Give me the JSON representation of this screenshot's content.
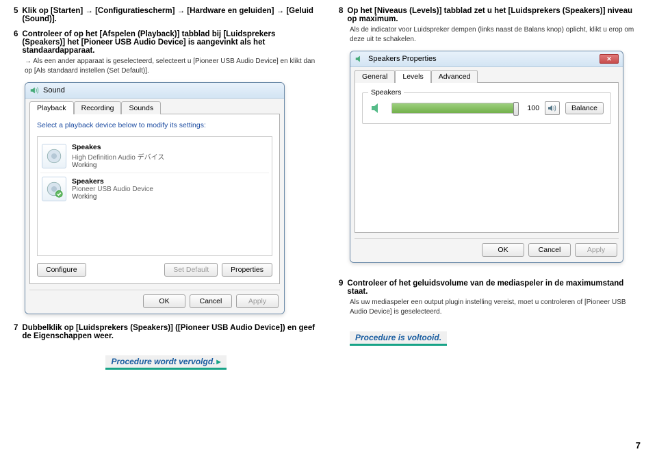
{
  "left": {
    "step5": {
      "num": "5",
      "text": "Klik op [Starten] → [Configuratiescherm] → [Hardware en geluiden] → [Geluid (Sound)]."
    },
    "step6": {
      "num": "6",
      "text": "Controleer of op het [Afspelen (Playback)] tabblad bij [Luidsprekers (Speakers)] het [Pioneer USB Audio Device] is aangevinkt als het standaardapparaat.",
      "note": "→ Als een ander apparaat is geselecteerd, selecteert u [Pioneer USB Audio Device] en klikt dan op [Als standaard instellen (Set Default)]."
    },
    "sound": {
      "title": "Sound",
      "tabs": {
        "playback": "Playback",
        "recording": "Recording",
        "sounds": "Sounds"
      },
      "prompt": "Select a playback device below to modify its settings:",
      "dev1": {
        "name": "Speakes",
        "sub": "High Definition Audio デバイス",
        "stat": "Working"
      },
      "dev2": {
        "name": "Speakers",
        "sub": "Pioneer USB Audio Device",
        "stat": "Working"
      },
      "buttons": {
        "configure": "Configure",
        "setdefault": "Set Default",
        "properties": "Properties",
        "ok": "OK",
        "cancel": "Cancel",
        "apply": "Apply"
      }
    },
    "step7": {
      "num": "7",
      "text": "Dubbelklik op [Luidsprekers (Speakers)] ([Pioneer USB Audio Device]) en geef de Eigenschappen weer."
    },
    "callout": "Procedure wordt vervolgd."
  },
  "right": {
    "step8": {
      "num": "8",
      "text": "Op het [Niveaus (Levels)] tabblad zet u het [Luidsprekers (Speakers)] niveau op maximum.",
      "note": "Als de indicator voor Luidspreker dempen (links naast de Balans knop) oplicht, klikt u erop om deze uit te schakelen."
    },
    "prop": {
      "title": "Speakers Properties",
      "tabs": {
        "general": "General",
        "levels": "Levels",
        "advanced": "Advanced"
      },
      "legend": "Speakers",
      "value": "100",
      "balance": "Balance",
      "buttons": {
        "ok": "OK",
        "cancel": "Cancel",
        "apply": "Apply"
      }
    },
    "step9": {
      "num": "9",
      "text": "Controleer of het geluidsvolume van de mediaspeler in de maximumstand staat.",
      "note": "Als uw mediaspeler een output plugin instelling vereist, moet u controleren of [Pioneer USB Audio Device] is geselecteerd."
    },
    "callout": "Procedure is voltooid."
  },
  "pagenum": "7"
}
